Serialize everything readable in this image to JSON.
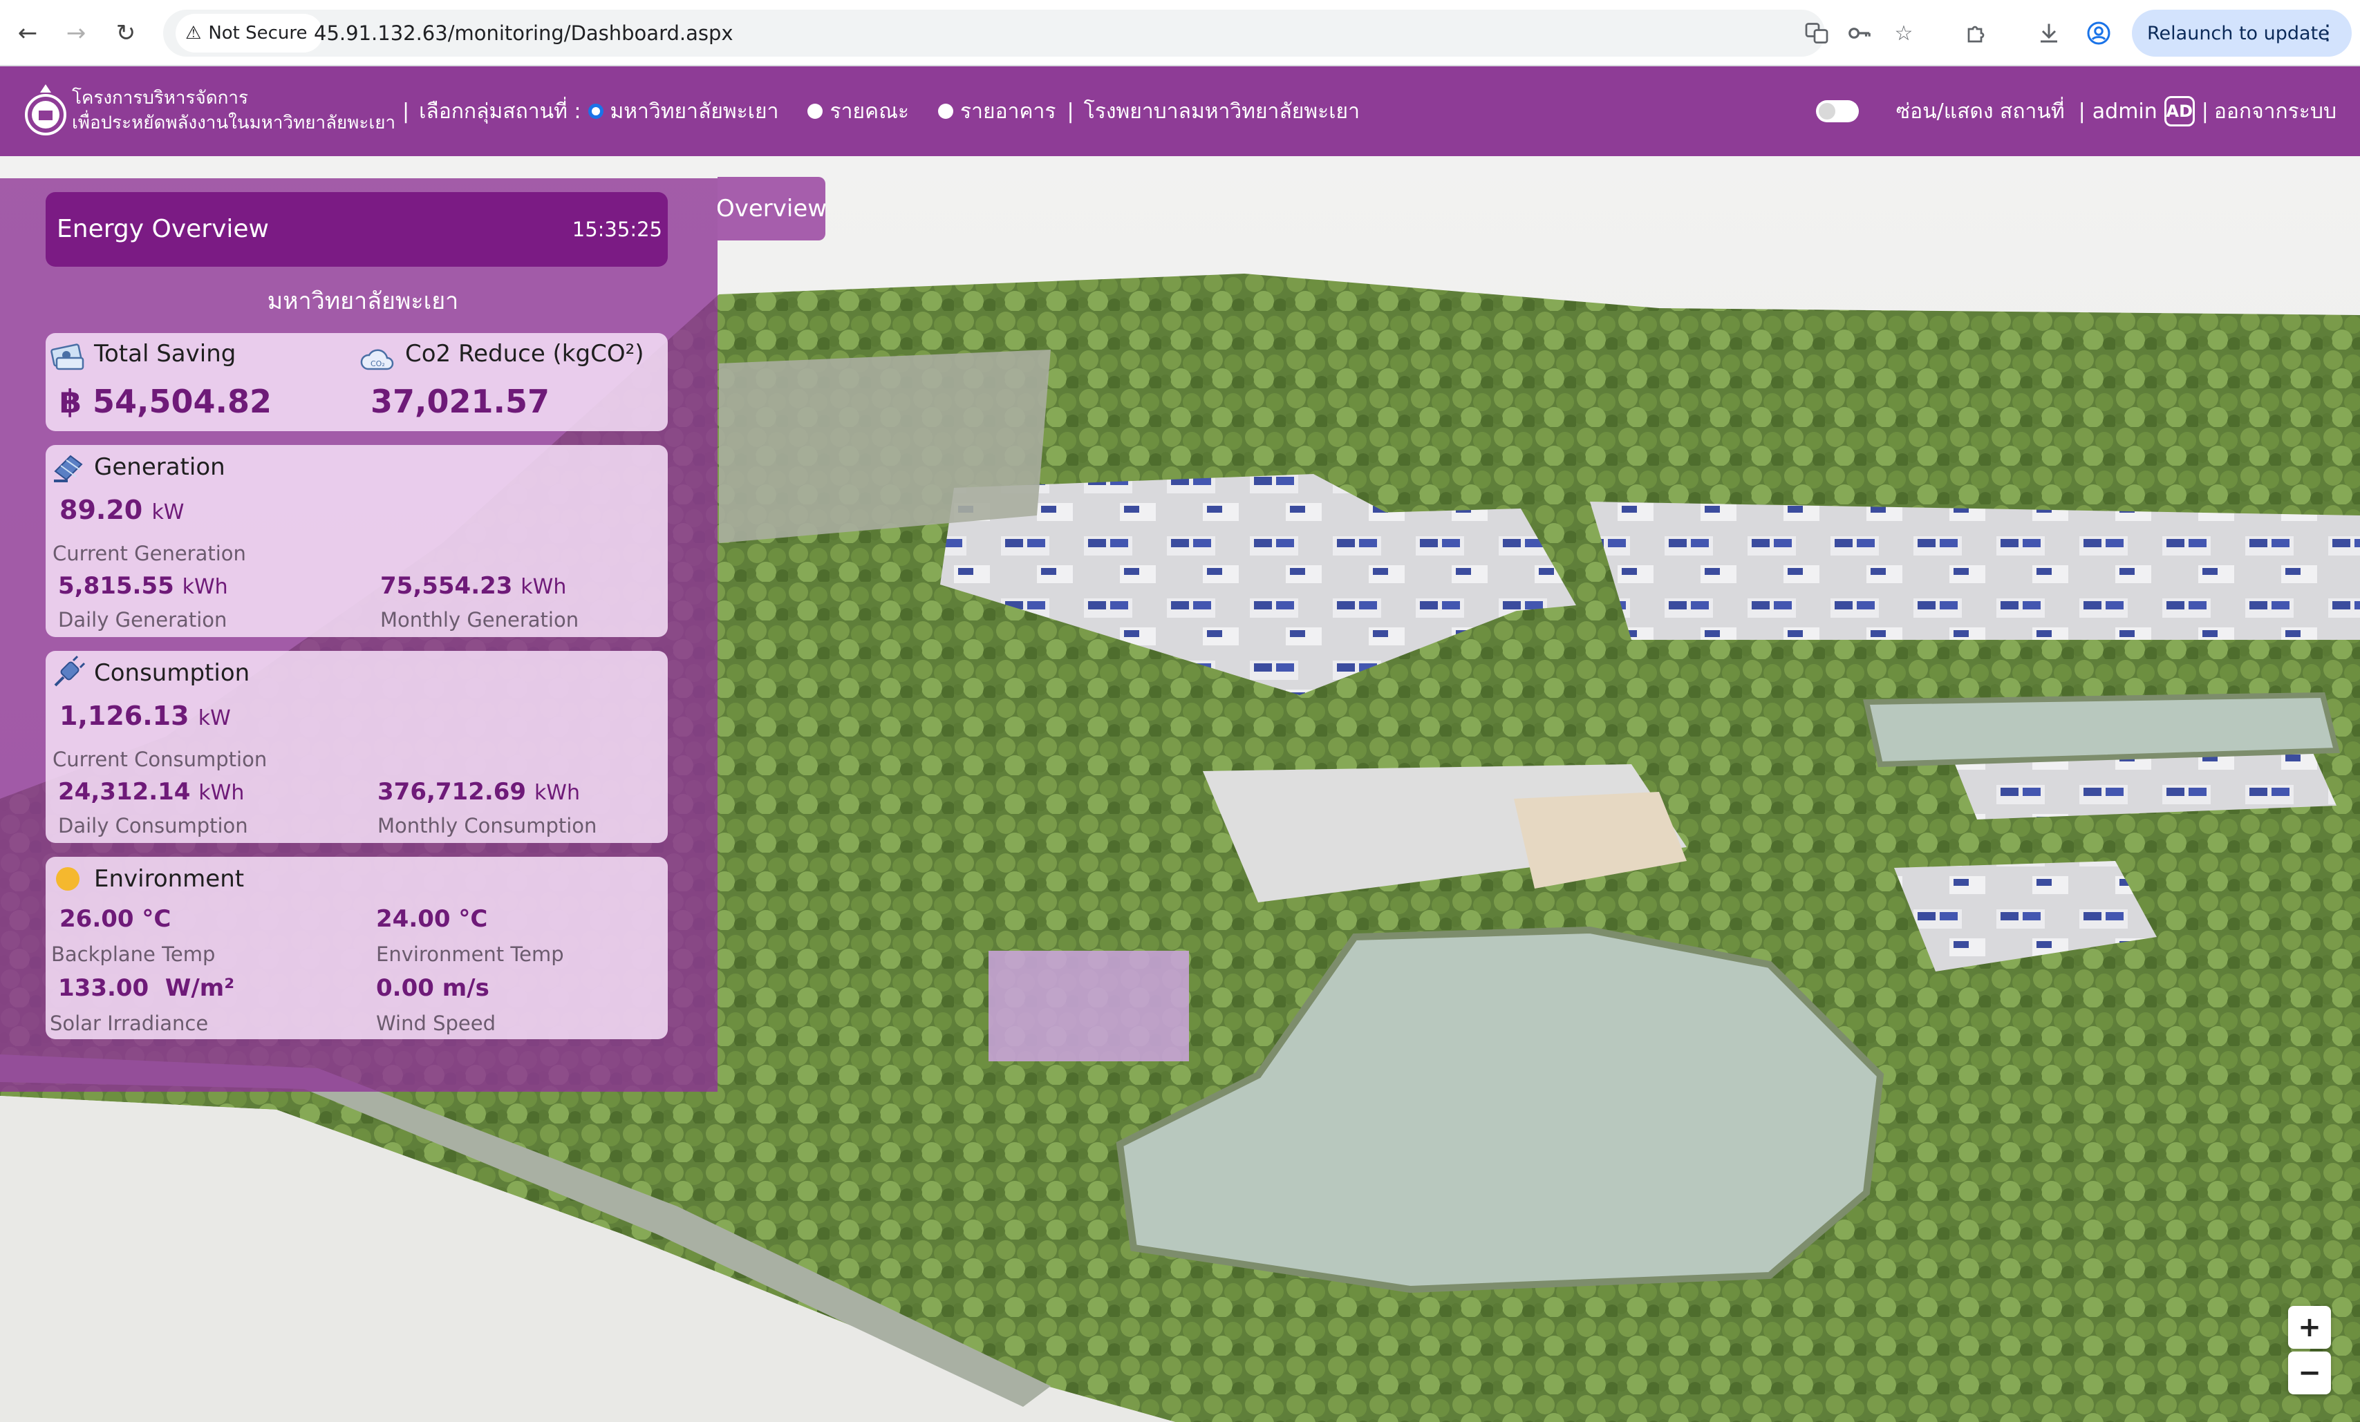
{
  "browser": {
    "security_label": "Not Secure",
    "url": "45.91.132.63/monitoring/Dashboard.aspx",
    "relaunch_label": "Relaunch to update"
  },
  "header": {
    "brand_line1": "โครงการบริหารจัดการ",
    "brand_line2": "เพื่อประหยัดพลังงานในมหาวิทยาลัยพะเยา",
    "site_group_label": "เลือกกลุ่มสถานที่ :",
    "options": [
      {
        "label": "มหาวิทยาลัยพะเยา",
        "selected": true
      },
      {
        "label": "รายคณะ",
        "selected": false
      },
      {
        "label": "รายอาคาร",
        "selected": false
      }
    ],
    "hospital_link": "โรงพยาบาลมหาวิทยาลัยพะเยา",
    "toggle_label": "ซ่อน/แสดง สถานที่",
    "user": "admin",
    "user_badge": "AD",
    "logout": "ออกจากระบบ",
    "accent_color": "#8e3c96"
  },
  "overview_tab": "Overview",
  "panel": {
    "title": "Energy Overview",
    "time": "15:35:25",
    "site_name": "มหาวิทยาลัยพะเยา",
    "saving": {
      "title": "Total Saving",
      "value": "฿ 54,504.82",
      "co2_title": "Co2 Reduce (kgCO²)",
      "co2_value": "37,021.57"
    },
    "generation": {
      "title": "Generation",
      "current_value": "89.20",
      "current_unit": "kW",
      "current_label": "Current Generation",
      "daily_value": "5,815.55",
      "daily_unit": "kWh",
      "daily_label": "Daily Generation",
      "monthly_value": "75,554.23",
      "monthly_unit": "kWh",
      "monthly_label": "Monthly Generation"
    },
    "consumption": {
      "title": "Consumption",
      "current_value": "1,126.13",
      "current_unit": "kW",
      "current_label": "Current Consumption",
      "daily_value": "24,312.14",
      "daily_unit": "kWh",
      "daily_label": "Daily Consumption",
      "monthly_value": "376,712.69",
      "monthly_unit": "kWh",
      "monthly_label": "Monthly Consumption"
    },
    "environment": {
      "title": "Environment",
      "backplane_value": "26.00",
      "backplane_unit": "°C",
      "backplane_label": "Backplane Temp",
      "env_value": "24.00",
      "env_unit": "°C",
      "env_label": "Environment Temp",
      "irradiance_value": "133.00",
      "irradiance_unit": "W/m²",
      "irradiance_label": "Solar Irradiance",
      "wind_value": "0.00",
      "wind_unit": "m/s",
      "wind_label": "Wind Speed"
    }
  },
  "map": {
    "zoom_in": "+",
    "zoom_out": "−"
  }
}
